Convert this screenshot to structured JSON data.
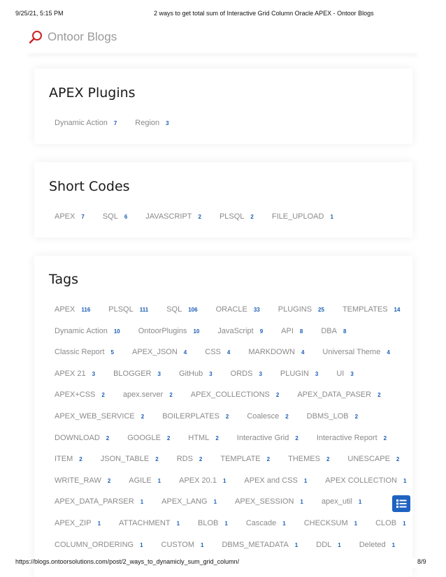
{
  "print_header": {
    "date": "9/25/21, 5:15 PM",
    "title": "2 ways to get total sum of Interactive Grid Column Oracle APEX - Ontoor Blogs"
  },
  "brand": {
    "name": "Ontoor Blogs",
    "icon": "magnifier-logo-icon",
    "accent": "#cc2222"
  },
  "apex_plugins": {
    "title": "APEX Plugins",
    "items": [
      {
        "name": "Dynamic Action",
        "count": "7"
      },
      {
        "name": "Region",
        "count": "3"
      }
    ]
  },
  "short_codes": {
    "title": "Short Codes",
    "items": [
      {
        "name": "APEX",
        "count": "7"
      },
      {
        "name": "SQL",
        "count": "6"
      },
      {
        "name": "JAVASCRIPT",
        "count": "2"
      },
      {
        "name": "PLSQL",
        "count": "2"
      },
      {
        "name": "FILE_UPLOAD",
        "count": "1"
      }
    ]
  },
  "tags": {
    "title": "Tags",
    "rows": [
      [
        {
          "name": "APEX",
          "count": "116"
        },
        {
          "name": "PLSQL",
          "count": "111"
        },
        {
          "name": "SQL",
          "count": "106"
        },
        {
          "name": "ORACLE",
          "count": "33"
        },
        {
          "name": "PLUGINS",
          "count": "25"
        },
        {
          "name": "TEMPLATES",
          "count": "14"
        }
      ],
      [
        {
          "name": "Dynamic Action",
          "count": "10"
        },
        {
          "name": "OntoorPlugins",
          "count": "10"
        },
        {
          "name": "JavaScript",
          "count": "9"
        },
        {
          "name": "API",
          "count": "8"
        },
        {
          "name": "DBA",
          "count": "8"
        }
      ],
      [
        {
          "name": "Classic Report",
          "count": "5"
        },
        {
          "name": "APEX_JSON",
          "count": "4"
        },
        {
          "name": "CSS",
          "count": "4"
        },
        {
          "name": "MARKDOWN",
          "count": "4"
        },
        {
          "name": "Universal Theme",
          "count": "4"
        }
      ],
      [
        {
          "name": "APEX 21",
          "count": "3"
        },
        {
          "name": "BLOGGER",
          "count": "3"
        },
        {
          "name": "GitHub",
          "count": "3"
        },
        {
          "name": "ORDS",
          "count": "3"
        },
        {
          "name": "PLUGIN",
          "count": "3"
        },
        {
          "name": "UI",
          "count": "3"
        }
      ],
      [
        {
          "name": "APEX+CSS",
          "count": "2"
        },
        {
          "name": "apex.server",
          "count": "2"
        },
        {
          "name": "APEX_COLLECTIONS",
          "count": "2"
        },
        {
          "name": "APEX_DATA_PASER",
          "count": "2"
        }
      ],
      [
        {
          "name": "APEX_WEB_SERVICE",
          "count": "2"
        },
        {
          "name": "BOILERPLATES",
          "count": "2"
        },
        {
          "name": "Coalesce",
          "count": "2"
        },
        {
          "name": "DBMS_LOB",
          "count": "2"
        }
      ],
      [
        {
          "name": "DOWNLOAD",
          "count": "2"
        },
        {
          "name": "GOOGLE",
          "count": "2"
        },
        {
          "name": "HTML",
          "count": "2"
        },
        {
          "name": "Interactive Grid",
          "count": "2"
        },
        {
          "name": "Interactive Report",
          "count": "2"
        }
      ],
      [
        {
          "name": "ITEM",
          "count": "2"
        },
        {
          "name": "JSON_TABLE",
          "count": "2"
        },
        {
          "name": "RDS",
          "count": "2"
        },
        {
          "name": "TEMPLATE",
          "count": "2"
        },
        {
          "name": "THEMES",
          "count": "2"
        },
        {
          "name": "UNESCAPE",
          "count": "2"
        }
      ],
      [
        {
          "name": "WRITE_RAW",
          "count": "2"
        },
        {
          "name": "AGILE",
          "count": "1"
        },
        {
          "name": "APEX 20.1",
          "count": "1"
        },
        {
          "name": "APEX and CSS",
          "count": "1"
        },
        {
          "name": "APEX COLLECTION",
          "count": "1"
        }
      ],
      [
        {
          "name": "APEX_DATA_PARSER",
          "count": "1"
        },
        {
          "name": "APEX_LANG",
          "count": "1"
        },
        {
          "name": "APEX_SESSION",
          "count": "1"
        },
        {
          "name": "apex_util",
          "count": "1"
        }
      ],
      [
        {
          "name": "APEX_ZIP",
          "count": "1"
        },
        {
          "name": "ATTACHMENT",
          "count": "1"
        },
        {
          "name": "BLOB",
          "count": "1"
        },
        {
          "name": "Cascade",
          "count": "1"
        },
        {
          "name": "CHECKSUM",
          "count": "1"
        },
        {
          "name": "CLOB",
          "count": "1"
        }
      ],
      [
        {
          "name": "COLUMN_ORDERING",
          "count": "1"
        },
        {
          "name": "CUSTOM",
          "count": "1"
        },
        {
          "name": "DBMS_METADATA",
          "count": "1"
        },
        {
          "name": "DDL",
          "count": "1"
        },
        {
          "name": "Deleted",
          "count": "1"
        }
      ]
    ]
  },
  "floating_button": {
    "icon": "list-icon",
    "color": "#1f63c2"
  },
  "print_footer": {
    "url": "https://blogs.ontoorsolutions.com/post/2_ways_to_dynamicly_sum_grid_column/",
    "page": "8/9"
  }
}
